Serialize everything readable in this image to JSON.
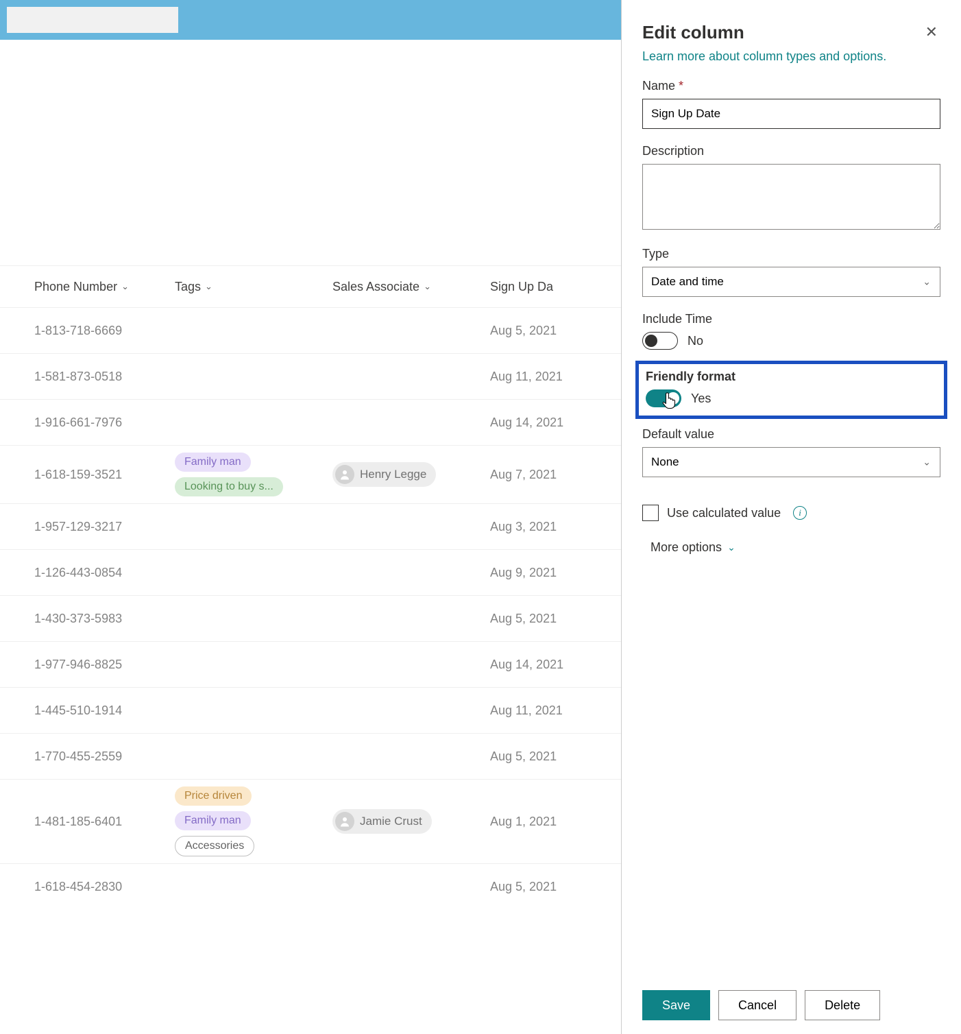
{
  "columns": {
    "phone": "Phone Number",
    "tags": "Tags",
    "associate": "Sales Associate",
    "date": "Sign Up Da"
  },
  "rows": [
    {
      "phone": "1-813-718-6669",
      "tags": [],
      "associate": "",
      "date": "Aug 5, 2021"
    },
    {
      "phone": "1-581-873-0518",
      "tags": [],
      "associate": "",
      "date": "Aug 11, 2021"
    },
    {
      "phone": "1-916-661-7976",
      "tags": [],
      "associate": "",
      "date": "Aug 14, 2021"
    },
    {
      "phone": "1-618-159-3521",
      "tags": [
        {
          "label": "Family man",
          "style": "tag-purple"
        },
        {
          "label": "Looking to buy s...",
          "style": "tag-green"
        }
      ],
      "associate": "Henry Legge",
      "date": "Aug 7, 2021"
    },
    {
      "phone": "1-957-129-3217",
      "tags": [],
      "associate": "",
      "date": "Aug 3, 2021"
    },
    {
      "phone": "1-126-443-0854",
      "tags": [],
      "associate": "",
      "date": "Aug 9, 2021"
    },
    {
      "phone": "1-430-373-5983",
      "tags": [],
      "associate": "",
      "date": "Aug 5, 2021"
    },
    {
      "phone": "1-977-946-8825",
      "tags": [],
      "associate": "",
      "date": "Aug 14, 2021"
    },
    {
      "phone": "1-445-510-1914",
      "tags": [],
      "associate": "",
      "date": "Aug 11, 2021"
    },
    {
      "phone": "1-770-455-2559",
      "tags": [],
      "associate": "",
      "date": "Aug 5, 2021"
    },
    {
      "phone": "1-481-185-6401",
      "tags": [
        {
          "label": "Price driven",
          "style": "tag-orange"
        },
        {
          "label": "Family man",
          "style": "tag-purple"
        },
        {
          "label": "Accessories",
          "style": "tag-outline"
        }
      ],
      "associate": "Jamie Crust",
      "date": "Aug 1, 2021"
    },
    {
      "phone": "1-618-454-2830",
      "tags": [],
      "associate": "",
      "date": "Aug 5, 2021"
    }
  ],
  "panel": {
    "title": "Edit column",
    "learn_link": "Learn more about column types and options.",
    "name_label": "Name",
    "name_value": "Sign Up Date",
    "desc_label": "Description",
    "desc_value": "",
    "type_label": "Type",
    "type_value": "Date and time",
    "include_time_label": "Include Time",
    "include_time_value": "No",
    "friendly_label": "Friendly format",
    "friendly_value": "Yes",
    "default_label": "Default value",
    "default_value": "None",
    "calc_label": "Use calculated value",
    "more_label": "More options",
    "save": "Save",
    "cancel": "Cancel",
    "delete": "Delete"
  }
}
